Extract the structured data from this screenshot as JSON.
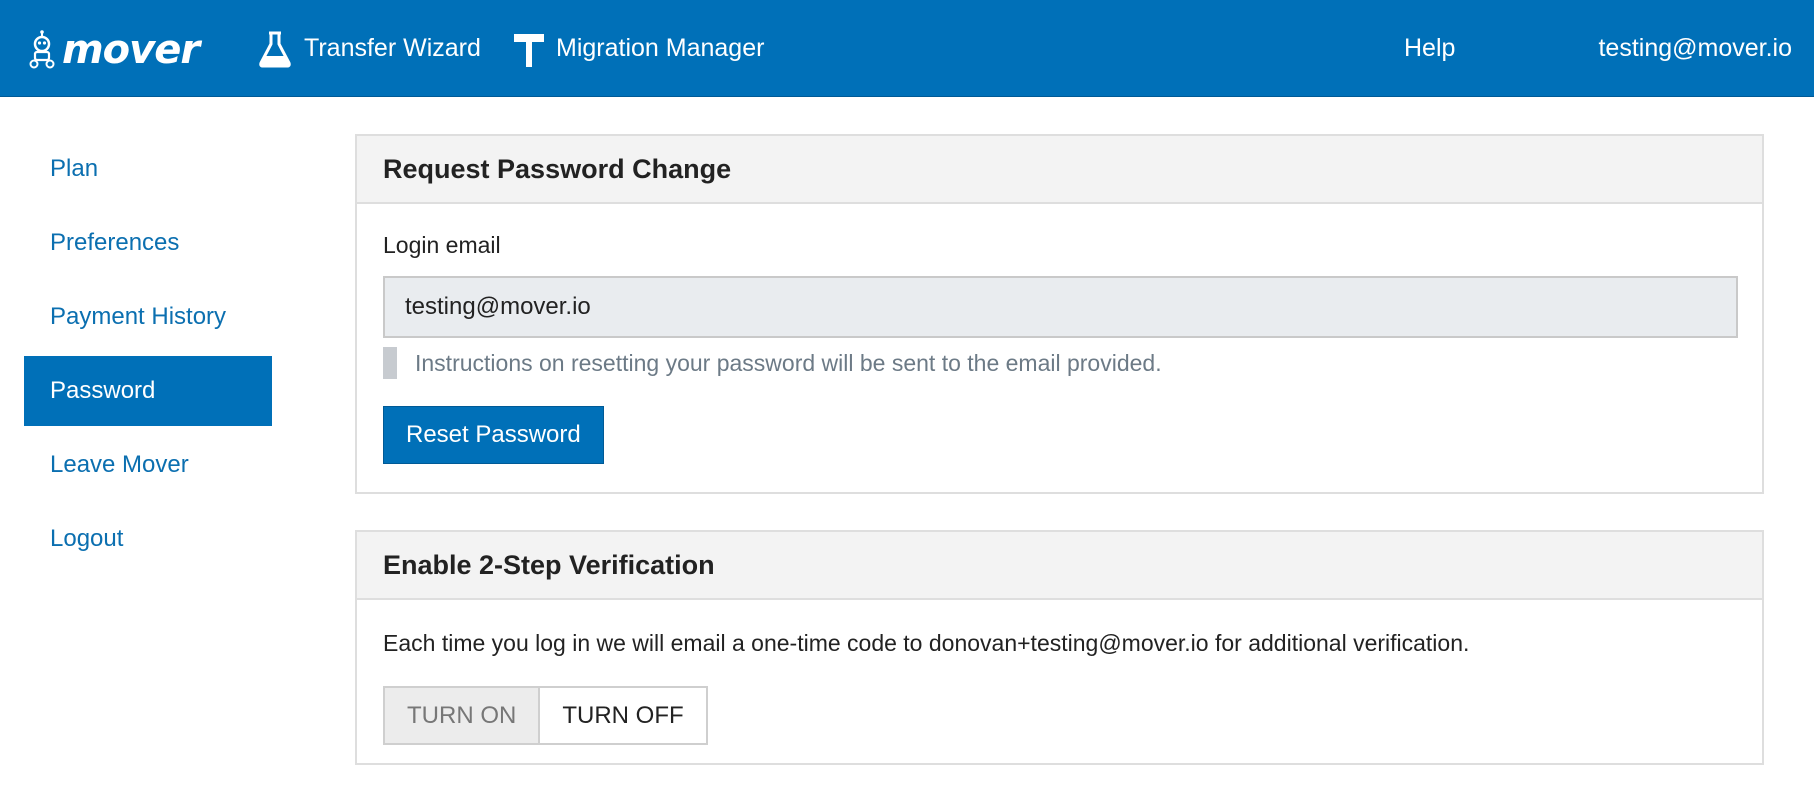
{
  "header": {
    "logo_text": "mover",
    "nav": [
      {
        "label": "Transfer Wizard",
        "icon": "flask-icon"
      },
      {
        "label": "Migration Manager",
        "icon": "signpost-icon"
      }
    ],
    "help_label": "Help",
    "user_email": "testing@mover.io"
  },
  "sidebar": {
    "items": [
      {
        "label": "Plan",
        "active": false
      },
      {
        "label": "Preferences",
        "active": false
      },
      {
        "label": "Payment History",
        "active": false
      },
      {
        "label": "Password",
        "active": true
      },
      {
        "label": "Leave Mover",
        "active": false
      },
      {
        "label": "Logout",
        "active": false
      }
    ]
  },
  "password_panel": {
    "title": "Request Password Change",
    "field_label": "Login email",
    "email_value": "testing@mover.io",
    "help_text": "Instructions on resetting your password will be sent to the email provided.",
    "reset_button": "Reset Password"
  },
  "verification_panel": {
    "title": "Enable 2-Step Verification",
    "description": "Each time you log in we will email a one-time code to donovan+testing@mover.io for additional verification.",
    "turn_on_label": "TURN ON",
    "turn_off_label": "TURN OFF"
  },
  "colors": {
    "brand": "#0070b8",
    "link": "#0b6fb0",
    "panel_header": "#f3f3f3"
  }
}
